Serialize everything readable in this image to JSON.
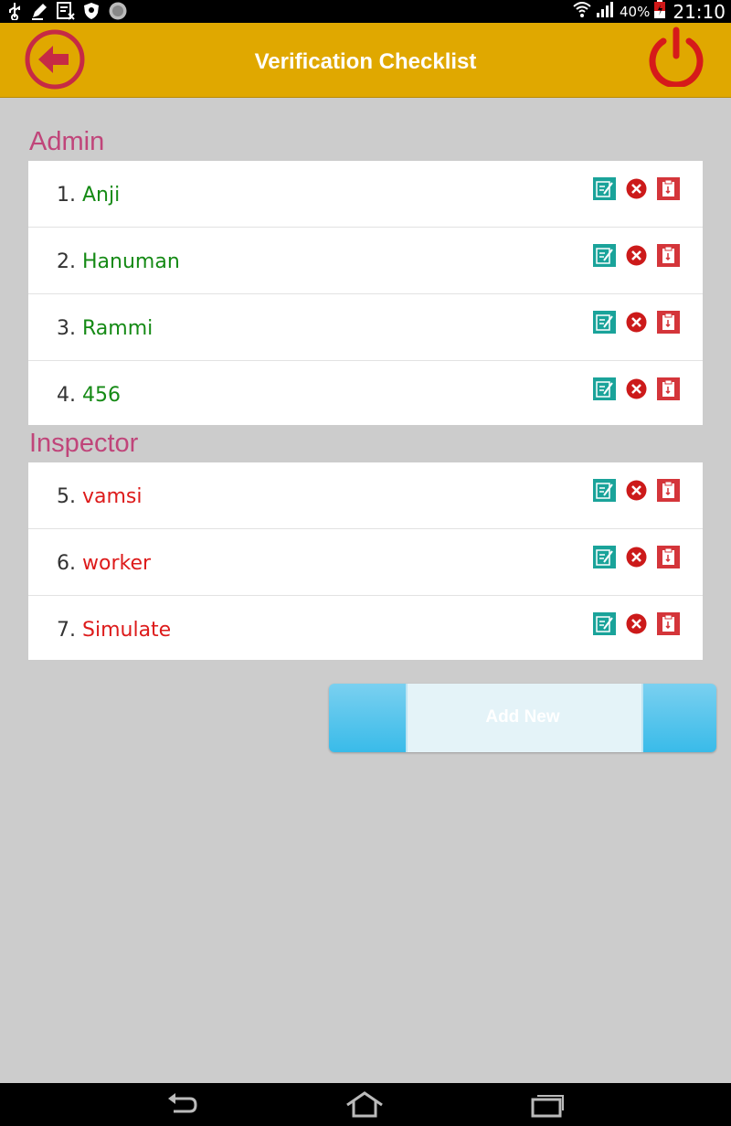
{
  "status_bar": {
    "battery_percent": "40%",
    "time": "21:10",
    "icons": [
      "usb-icon",
      "pencil-icon",
      "sim-icon",
      "shield-icon",
      "app-icon",
      "wifi-icon",
      "signal-icon",
      "battery-icon"
    ]
  },
  "header": {
    "title": "Verification Checklist",
    "back_icon": "back-arrow-icon",
    "power_icon": "power-icon"
  },
  "colors": {
    "header_bg": "#e0a800",
    "section_title": "#c0457a",
    "admin_name": "#158a15",
    "inspector_name": "#dd1b1b",
    "edit_icon": "#1aa39a",
    "delete_icon": "#cc1a1a",
    "clipboard_icon": "#d4353a",
    "button_accent": "#39bbe9"
  },
  "sections": [
    {
      "title": "Admin",
      "items": [
        {
          "num": "1.",
          "name": "Anji"
        },
        {
          "num": "2.",
          "name": "Hanuman"
        },
        {
          "num": "3.",
          "name": "Rammi"
        },
        {
          "num": "4.",
          "name": "456"
        }
      ]
    },
    {
      "title": "Inspector",
      "items": [
        {
          "num": "5.",
          "name": "vamsi"
        },
        {
          "num": "6.",
          "name": "worker"
        },
        {
          "num": "7.",
          "name": "Simulate"
        }
      ]
    }
  ],
  "actions": [
    "edit-icon",
    "delete-icon",
    "clipboard-icon"
  ],
  "add_new_label": "Add New",
  "nav_bar": [
    "back-nav-icon",
    "home-nav-icon",
    "recent-apps-icon"
  ]
}
